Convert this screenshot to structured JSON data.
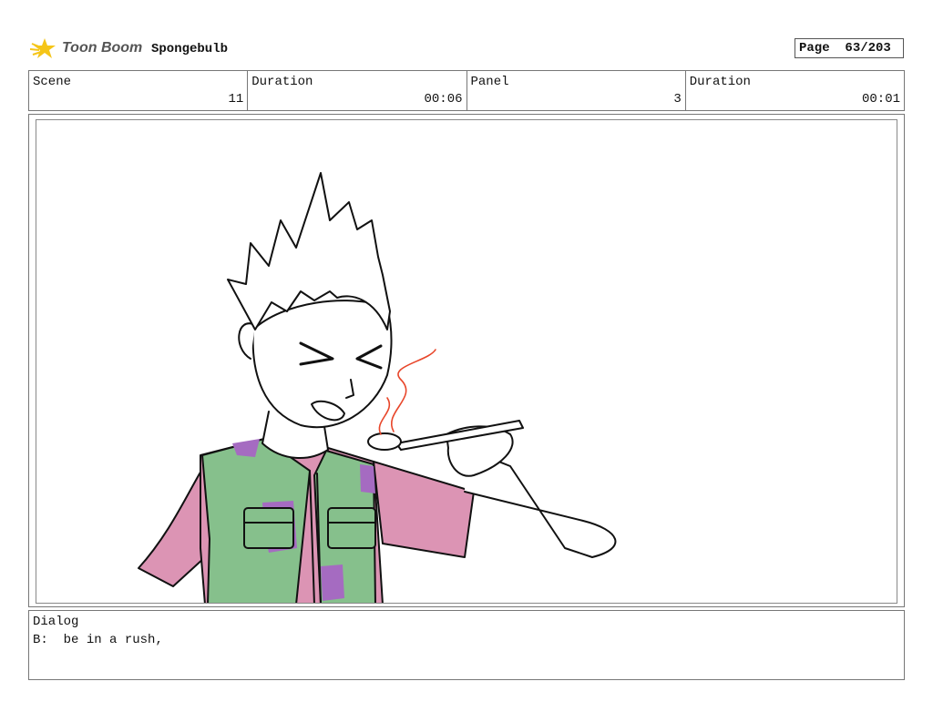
{
  "header": {
    "brand": "Toon Boom",
    "project": "Spongebulb",
    "page_label": "Page",
    "page_value": "63/203"
  },
  "info": {
    "scene_label": "Scene",
    "scene_value": "11",
    "scene_duration_label": "Duration",
    "scene_duration_value": "00:06",
    "panel_label": "Panel",
    "panel_value": "3",
    "panel_duration_label": "Duration",
    "panel_duration_value": "00:01"
  },
  "dialog": {
    "title": "Dialog",
    "speaker": "B:",
    "text": "be in a rush,"
  },
  "colors": {
    "shirt": "#dc94b4",
    "vest": "#86c08c",
    "vest_patch": "#a56bc1",
    "steam": "#e8462a",
    "logo_star": "#f5c518"
  }
}
